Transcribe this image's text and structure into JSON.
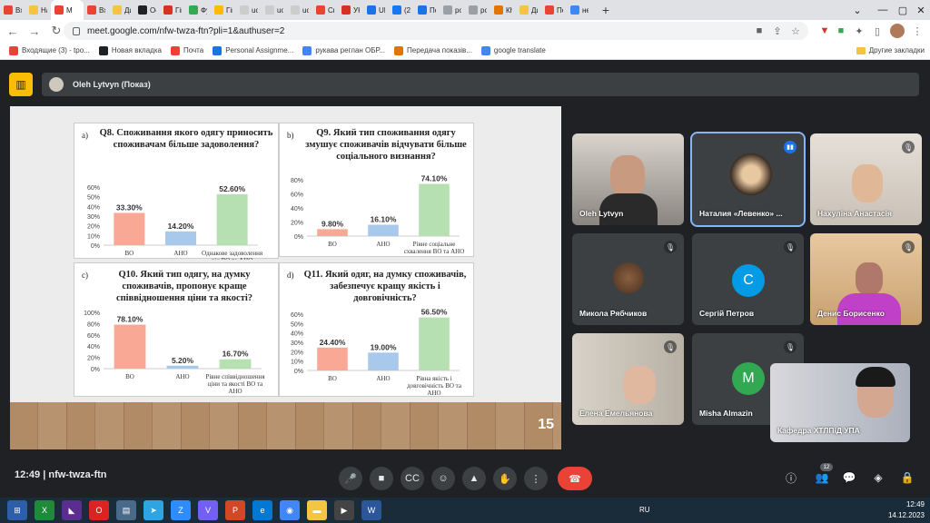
{
  "browser": {
    "tabs": [
      {
        "label": "Вх",
        "color": "#ea4335"
      },
      {
        "label": "На",
        "color": "#f4c542"
      },
      {
        "label": "М",
        "color": "#ea4335",
        "active": true
      },
      {
        "label": "Вх",
        "color": "#ea4335"
      },
      {
        "label": "Ди",
        "color": "#f4c542"
      },
      {
        "label": "Ос",
        "color": "#202124"
      },
      {
        "label": "Гіп",
        "color": "#d93025"
      },
      {
        "label": "Фу",
        "color": "#34a853"
      },
      {
        "label": "Гіп",
        "color": "#fbbc04"
      },
      {
        "label": "uo",
        "color": "#cccccc"
      },
      {
        "label": "uo",
        "color": "#cccccc"
      },
      {
        "label": "uo",
        "color": "#cccccc"
      },
      {
        "label": "Ск",
        "color": "#ea4335"
      },
      {
        "label": "УК",
        "color": "#d93025"
      },
      {
        "label": "UE",
        "color": "#1a73e8"
      },
      {
        "label": "(2(",
        "color": "#1877f2"
      },
      {
        "label": "По",
        "color": "#1a73e8"
      },
      {
        "label": "ро",
        "color": "#9aa0a6"
      },
      {
        "label": "ро",
        "color": "#9aa0a6"
      },
      {
        "label": "Кh",
        "color": "#e37400"
      },
      {
        "label": "Ди",
        "color": "#f4c542"
      },
      {
        "label": "По",
        "color": "#ea4335"
      },
      {
        "label": "не",
        "color": "#4285f4"
      }
    ],
    "new_tab": "+",
    "url": "meet.google.com/nfw-twza-ftn?pli=1&authuser=2",
    "bookmarks": [
      {
        "label": "Входящие (3) - tpo...",
        "color": "#ea4335"
      },
      {
        "label": "Новая вкладка",
        "color": "#202124"
      },
      {
        "label": "Почта",
        "color": "#ea4335"
      },
      {
        "label": "Personal Assignme...",
        "color": "#1a73e8"
      },
      {
        "label": "рукава реглан ОБР...",
        "color": "#4285f4"
      },
      {
        "label": "Передача показів...",
        "color": "#e37400"
      },
      {
        "label": "google translate",
        "color": "#4285f4"
      }
    ],
    "other_bookmarks": "Другие закладки"
  },
  "meet": {
    "presenter": "Oleh Lytvyn (Показ)",
    "time": "12:49",
    "meeting_code": "nfw-twza-ftn",
    "participant_count": "12",
    "participants": [
      {
        "name": "Oleh Lytvyn",
        "muted": false,
        "type": "video"
      },
      {
        "name": "Наталия «Левенко» ...",
        "muted": false,
        "type": "photo",
        "speaking": true
      },
      {
        "name": "Нахуліна Анастасія",
        "muted": true,
        "type": "video"
      },
      {
        "name": "Микола Рябчиков",
        "muted": true,
        "type": "photo"
      },
      {
        "name": "Сергій Петров",
        "muted": true,
        "type": "letter",
        "letter": "C",
        "color": "#039be5"
      },
      {
        "name": "Денис Борисенко",
        "muted": true,
        "type": "video"
      },
      {
        "name": "Елена Емельянова",
        "muted": true,
        "type": "video"
      },
      {
        "name": "Misha Almazin",
        "muted": true,
        "type": "letter",
        "letter": "M",
        "color": "#33a852"
      },
      {
        "name": "Кафедра ХТЛПіД УПА",
        "muted": false,
        "type": "video"
      }
    ]
  },
  "slide": {
    "page_number": "15",
    "panels": [
      {
        "letter": "a)",
        "title": "Q8. Споживання якого одягу приносить споживачам більше задоволення?"
      },
      {
        "letter": "b)",
        "title": "Q9. Який тип споживання одягу змушує споживачів відчувати більше соціального визнання?"
      },
      {
        "letter": "c)",
        "title": "Q10. Який тип одягу, на думку споживачів, пропонує краще співвідношення ціни та якості?"
      },
      {
        "letter": "d)",
        "title": "Q11. Який одяг, на думку споживачів, забезпечує кращу якість і довговічність?"
      }
    ]
  },
  "chart_data": [
    {
      "type": "bar",
      "title": "Q8. Споживання якого одягу приносить споживачам більше задоволення?",
      "categories": [
        "ВО",
        "АНО",
        "Однакове задоволення від ВО та АНО"
      ],
      "values": [
        33.3,
        14.2,
        52.6
      ],
      "value_labels": [
        "33.30%",
        "14.20%",
        "52.60%"
      ],
      "colors": [
        "#f8a895",
        "#a8c8ec",
        "#b7e0b2"
      ],
      "ylim": [
        0,
        60
      ],
      "yticks": [
        "0%",
        "10%",
        "20%",
        "30%",
        "40%",
        "50%",
        "60%"
      ]
    },
    {
      "type": "bar",
      "title": "Q9. Який тип споживання одягу змушує споживачів відчувати більше соціального визнання?",
      "categories": [
        "ВО",
        "АНО",
        "Рівне соціальне схвалення ВО та АНО"
      ],
      "values": [
        9.8,
        16.1,
        74.1
      ],
      "value_labels": [
        "9.80%",
        "16.10%",
        "74.10%"
      ],
      "colors": [
        "#f8a895",
        "#a8c8ec",
        "#b7e0b2"
      ],
      "ylim": [
        0,
        80
      ],
      "yticks": [
        "0%",
        "20%",
        "40%",
        "60%",
        "80%"
      ]
    },
    {
      "type": "bar",
      "title": "Q10. Який тип одягу, на думку споживачів, пропонує краще співвідношення ціни та якості?",
      "categories": [
        "ВО",
        "АНО",
        "Рівне співвідношення ціни та якості ВО та АНО"
      ],
      "values": [
        78.1,
        5.2,
        16.7
      ],
      "value_labels": [
        "78.10%",
        "5.20%",
        "16.70%"
      ],
      "colors": [
        "#f8a895",
        "#a8c8ec",
        "#b7e0b2"
      ],
      "ylim": [
        0,
        100
      ],
      "yticks": [
        "0%",
        "20%",
        "40%",
        "60%",
        "80%",
        "100%"
      ]
    },
    {
      "type": "bar",
      "title": "Q11. Який одяг, на думку споживачів, забезпечує кращу якість і довговічність?",
      "categories": [
        "ВО",
        "АНО",
        "Рівна якість і довговічність ВО та АНО"
      ],
      "values": [
        24.4,
        19.0,
        56.5
      ],
      "value_labels": [
        "24.40%",
        "19.00%",
        "56.50%"
      ],
      "colors": [
        "#f8a895",
        "#a8c8ec",
        "#b7e0b2"
      ],
      "ylim": [
        0,
        60
      ],
      "yticks": [
        "0%",
        "10%",
        "20%",
        "30%",
        "40%",
        "50%",
        "60%"
      ]
    }
  ],
  "taskbar": {
    "lang": "RU",
    "clock_time": "12:49",
    "clock_date": "14.12.2023"
  }
}
